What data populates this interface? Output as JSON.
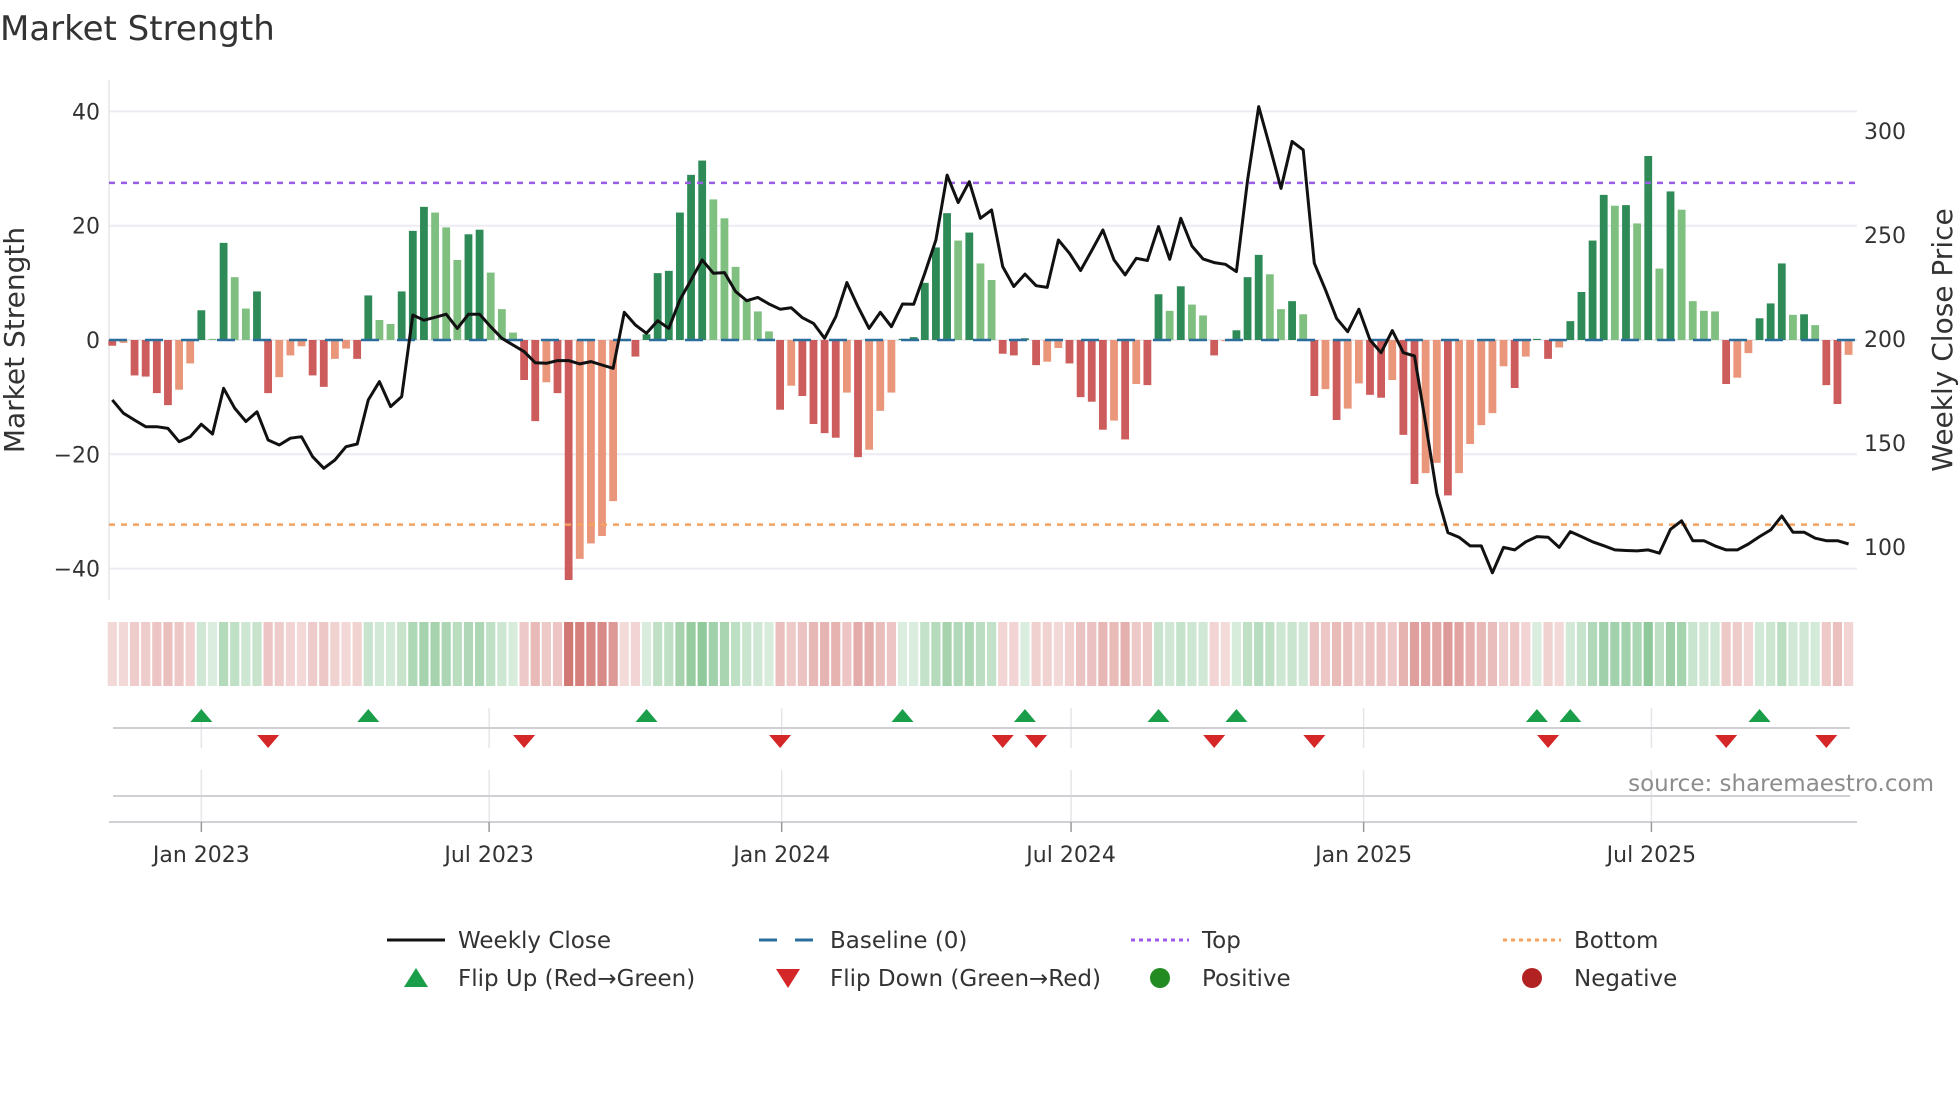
{
  "chart_data": {
    "type": "bar",
    "title": "Market Strength",
    "ylabel": "Market Strength",
    "y2label": "Weekly Close Price",
    "ylim": [
      -45.5,
      45.5
    ],
    "y2lim": [
      74.5,
      324.5
    ],
    "yticks": [
      40,
      20,
      0,
      -20,
      -40
    ],
    "ytick_labels": [
      "40",
      "20",
      "0",
      "−20",
      "−40"
    ],
    "y2ticks": [
      300,
      250,
      200,
      150,
      100
    ],
    "y2tick_labels": [
      "300",
      "250",
      "200",
      "150",
      "100"
    ],
    "x_start": "2022-11-06",
    "x_interval": "weekly",
    "xticks": [
      {
        "date": "2023-01-01",
        "label": "Jan 2023"
      },
      {
        "date": "2023-07-01",
        "label": "Jul 2023"
      },
      {
        "date": "2024-01-01",
        "label": "Jan 2024"
      },
      {
        "date": "2024-07-01",
        "label": "Jul 2024"
      },
      {
        "date": "2025-01-01",
        "label": "Jan 2025"
      },
      {
        "date": "2025-07-01",
        "label": "Jul 2025"
      }
    ],
    "top_level": 27.5,
    "bottom_level": -32.3,
    "baseline": 0,
    "series": [
      {
        "name": "Market Strength",
        "type": "bar",
        "values": [
          -1,
          -0.5,
          -6.2,
          -6.4,
          -9.3,
          -11.4,
          -8.7,
          -4.1,
          5.2,
          0.2,
          17,
          11,
          5.5,
          8.5,
          -9.3,
          -6.5,
          -2.7,
          -1.1,
          -6.2,
          -8.2,
          -3.3,
          -1.5,
          -3.3,
          7.8,
          3.5,
          2.8,
          8.5,
          19.1,
          23.3,
          22.3,
          19.7,
          14,
          18.5,
          19.3,
          11.8,
          5.4,
          1.3,
          -7,
          -14.2,
          -7.4,
          -9.3,
          -42,
          -38.3,
          -35.6,
          -34.3,
          -28.2,
          -0.2,
          -2.9,
          1,
          11.7,
          12.1,
          22.3,
          28.9,
          31.4,
          24.6,
          21.3,
          12.8,
          6.9,
          5,
          1.5,
          -12.2,
          -8,
          -9.8,
          -14.7,
          -16.3,
          -17.1,
          -9.2,
          -20.5,
          -19.2,
          -12.4,
          -9.2,
          0.2,
          0.5,
          10,
          16.2,
          22.2,
          17.4,
          18.8,
          13.4,
          10.5,
          -2.4,
          -2.7,
          0.3,
          -4.4,
          -3.8,
          -1.4,
          -4.1,
          -10,
          -10.8,
          -15.7,
          -14.1,
          -17.4,
          -7.7,
          -7.9,
          8,
          5.1,
          9.4,
          6.2,
          4.3,
          -2.7,
          -0.2,
          1.7,
          11,
          14.9,
          11.5,
          5.4,
          6.8,
          4.5,
          -9.8,
          -8.6,
          -14,
          -12,
          -7.6,
          -9.6,
          -10.1,
          -7,
          -16.6,
          -25.2,
          -23.3,
          -21.5,
          -27.2,
          -23.3,
          -18.2,
          -14.9,
          -12.8,
          -4.6,
          -8.4,
          -2.9,
          0.2,
          -3.3,
          -1.3,
          3.3,
          8.4,
          17.4,
          25.4,
          23.5,
          23.6,
          20.4,
          32.2,
          12.5,
          26,
          22.8,
          6.8,
          5.1,
          5,
          -7.7,
          -6.6,
          -2.3,
          3.8,
          6.4,
          13.4,
          4.4,
          4.5,
          2.6,
          -7.9,
          -11.2,
          -2.6
        ]
      },
      {
        "name": "Weekly Close",
        "type": "line",
        "axis": "right",
        "values": [
          170.7,
          164.3,
          161,
          157.8,
          157.8,
          157,
          150.6,
          153,
          159,
          154.3,
          176.3,
          166.7,
          160.3,
          165,
          151.4,
          149,
          152.3,
          153,
          143.4,
          137.8,
          141.8,
          148.2,
          149.5,
          170.7,
          179.5,
          167.5,
          172.3,
          211.5,
          209,
          210.4,
          211.9,
          205.1,
          211.9,
          211.9,
          205.9,
          200.3,
          197.1,
          193.9,
          188.6,
          188.3,
          189.6,
          189.6,
          188,
          189.1,
          187.5,
          185.9,
          212.8,
          206.7,
          202.7,
          208.8,
          205.1,
          218.8,
          228.4,
          238,
          231.6,
          231.9,
          222.8,
          218.4,
          220,
          216.8,
          214.3,
          215,
          210.2,
          207.5,
          200.3,
          210.7,
          227.1,
          215.5,
          205.1,
          212.8,
          205.9,
          216.8,
          216.7,
          231.6,
          247.6,
          278.8,
          265.6,
          275.6,
          258,
          262,
          234.8,
          225.2,
          231.2,
          225.6,
          224.8,
          247.6,
          241.2,
          232.9,
          242.5,
          252.4,
          238,
          230.8,
          238.8,
          237.7,
          254,
          238.3,
          258,
          244.7,
          238.5,
          236.7,
          235.9,
          232.4,
          276.4,
          311.7,
          292.5,
          272.4,
          295,
          290.9,
          236.4,
          223.6,
          209.9,
          203.5,
          214.3,
          199.5,
          193.4,
          204,
          193.4,
          191.8,
          159.5,
          125.8,
          106.9,
          104.7,
          100.5,
          100.5,
          87.6,
          99.8,
          98.6,
          102.5,
          105,
          104.7,
          99.8,
          107.4,
          105,
          102.5,
          100.6,
          98.6,
          98.3,
          98.1,
          98.6,
          97,
          108.5,
          112.6,
          103,
          103,
          100.5,
          98.6,
          98.6,
          101.4,
          105,
          108.2,
          114.9,
          107.1,
          107.1,
          104.2,
          103,
          103,
          101.4
        ]
      }
    ],
    "colors": {
      "strong_green": "#2e8b57",
      "weak_green": "#7fbf7f",
      "strong_red": "#cd5c5c",
      "weak_red": "#e9967a",
      "line": "#111111",
      "baseline": "#2c6e9b",
      "top": "#9b5de5",
      "bottom": "#f4a261",
      "flip_up": "#1a9e4a",
      "flip_down": "#d62728",
      "positive": "#228b22",
      "negative": "#b22222"
    },
    "legend": {
      "placement": "bottom",
      "entries": [
        {
          "label": "Weekly Close",
          "symbol": "line"
        },
        {
          "label": "Baseline (0)",
          "symbol": "dashed"
        },
        {
          "label": "Top",
          "symbol": "dotted-purple"
        },
        {
          "label": "Bottom",
          "symbol": "dotted-orange"
        },
        {
          "label": "Flip Up (Red→Green)",
          "symbol": "triangle-up"
        },
        {
          "label": "Flip Down (Green→Red)",
          "symbol": "triangle-down"
        },
        {
          "label": "Positive",
          "symbol": "circle-green"
        },
        {
          "label": "Negative",
          "symbol": "circle-red"
        }
      ]
    },
    "source": "source: sharemaestro.com"
  }
}
